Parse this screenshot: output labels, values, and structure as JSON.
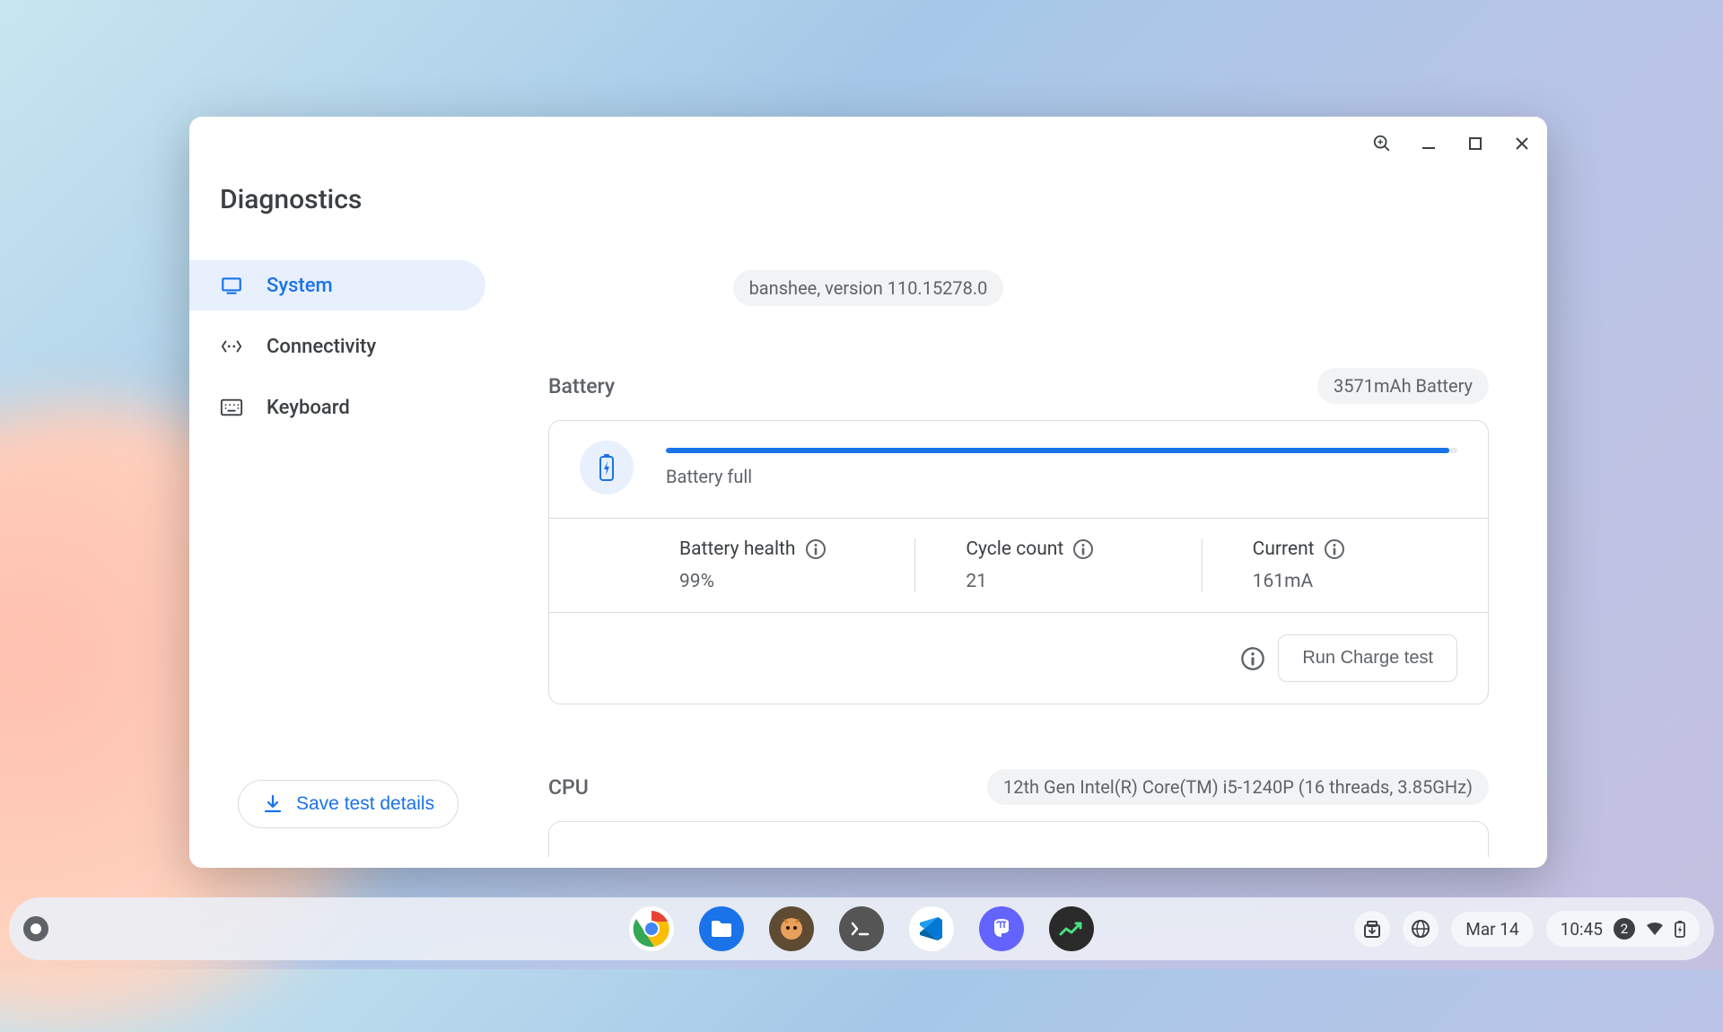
{
  "window": {
    "title": "Diagnostics",
    "version_chip": "banshee, version 110.15278.0"
  },
  "nav": {
    "items": [
      {
        "label": "System"
      },
      {
        "label": "Connectivity"
      },
      {
        "label": "Keyboard"
      }
    ]
  },
  "battery": {
    "section_title": "Battery",
    "capacity_chip": "3571mAh Battery",
    "status_text": "Battery full",
    "stats": {
      "health_label": "Battery health",
      "health_value": "99%",
      "cycle_label": "Cycle count",
      "cycle_value": "21",
      "current_label": "Current",
      "current_value": "161mA"
    },
    "run_test_label": "Run Charge test"
  },
  "cpu": {
    "section_title": "CPU",
    "chip": "12th Gen Intel(R) Core(TM) i5-1240P (16 threads, 3.85GHz)"
  },
  "save_button_label": "Save test details",
  "shelf": {
    "date": "Mar 14",
    "time": "10:45",
    "notif_count": "2"
  }
}
